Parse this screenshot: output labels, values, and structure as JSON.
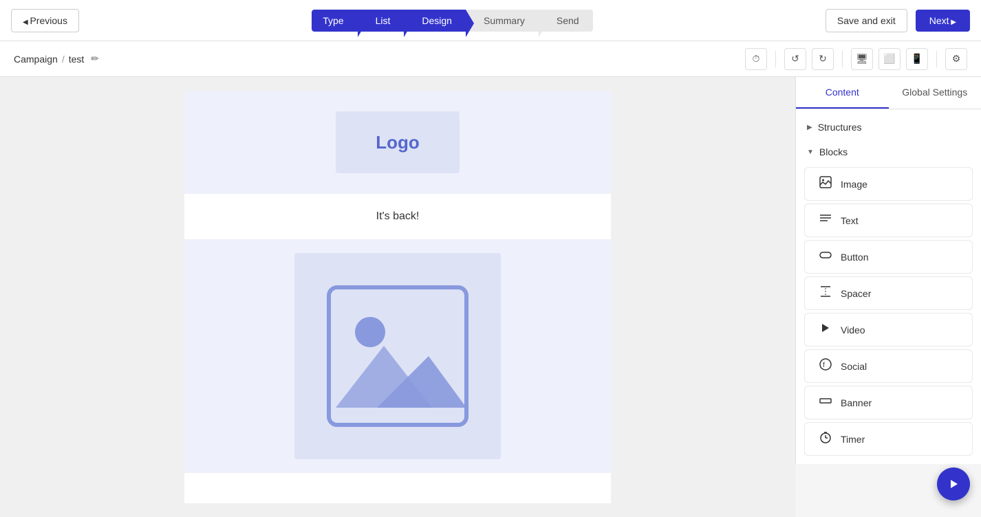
{
  "nav": {
    "previous_label": "Previous",
    "next_label": "Next ▶",
    "save_exit_label": "Save and exit",
    "steps": [
      {
        "id": "type",
        "label": "Type",
        "state": "active"
      },
      {
        "id": "list",
        "label": "List",
        "state": "active"
      },
      {
        "id": "design",
        "label": "Design",
        "state": "active"
      },
      {
        "id": "summary",
        "label": "Summary",
        "state": "inactive"
      },
      {
        "id": "send",
        "label": "Send",
        "state": "inactive"
      }
    ]
  },
  "breadcrumb": {
    "campaign_label": "Campaign",
    "separator": "/",
    "name": "test"
  },
  "canvas": {
    "logo_text": "Logo",
    "body_text": "It's back!"
  },
  "panel": {
    "tabs": [
      {
        "id": "content",
        "label": "Content",
        "active": true
      },
      {
        "id": "global_settings",
        "label": "Global Settings",
        "active": false
      }
    ],
    "structures_label": "Structures",
    "blocks_label": "Blocks",
    "blocks": [
      {
        "id": "image",
        "label": "Image",
        "icon": "🖼"
      },
      {
        "id": "text",
        "label": "Text",
        "icon": "≡"
      },
      {
        "id": "button",
        "label": "Button",
        "icon": "⬜"
      },
      {
        "id": "spacer",
        "label": "Spacer",
        "icon": "⬛"
      },
      {
        "id": "video",
        "label": "Video",
        "icon": "▶"
      },
      {
        "id": "social",
        "label": "Social",
        "icon": "ⓕ"
      },
      {
        "id": "banner",
        "label": "Banner",
        "icon": "▬"
      },
      {
        "id": "timer",
        "label": "Timer",
        "icon": "⏱"
      }
    ]
  },
  "fab": {
    "icon": "▶"
  }
}
